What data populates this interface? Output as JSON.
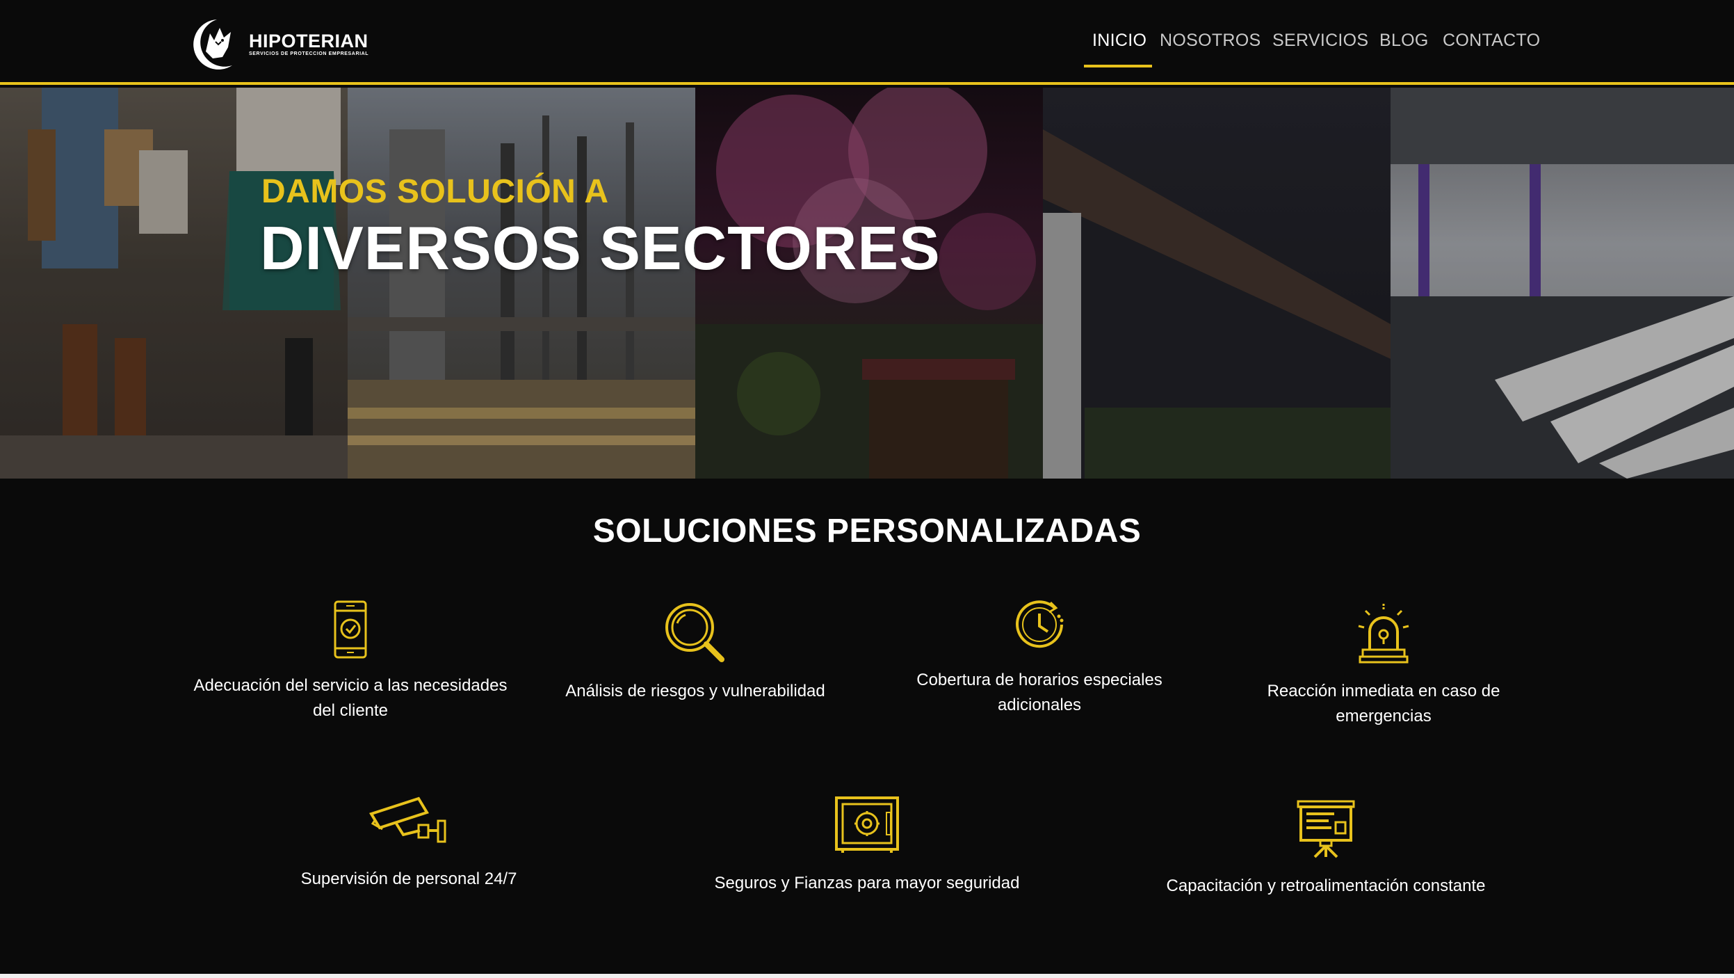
{
  "brand": {
    "name": "HIPOTERIAN",
    "tagline": "SERVICIOS DE PROTECCION EMPRESARIAL",
    "accent_color": "#e8c21c"
  },
  "nav": {
    "items": [
      {
        "label": "INICIO",
        "active": true
      },
      {
        "label": "NOSOTROS",
        "active": false
      },
      {
        "label": "SERVICIOS",
        "active": false
      },
      {
        "label": "BLOG",
        "active": false
      },
      {
        "label": "CONTACTO",
        "active": false
      }
    ]
  },
  "hero": {
    "kicker": "DAMOS SOLUCIÓN A",
    "title": "DIVERSOS SECTORES",
    "panels": [
      "retail-shoppers",
      "construction-site",
      "event-fireworks",
      "building-exterior",
      "office-interior"
    ]
  },
  "solutions": {
    "title": "SOLUCIONES PERSONALIZADAS",
    "items": [
      {
        "icon": "phone-check-icon",
        "label": "Adecuación del servicio a las necesidades del cliente"
      },
      {
        "icon": "magnifier-icon",
        "label": "Análisis de riesgos y vulnerabilidad"
      },
      {
        "icon": "clock-icon",
        "label": "Cobertura de horarios especiales adicionales"
      },
      {
        "icon": "siren-icon",
        "label": "Reacción inmediata en caso de emergencias"
      },
      {
        "icon": "security-camera-icon",
        "label": "Supervisión de personal 24/7"
      },
      {
        "icon": "safe-icon",
        "label": "Seguros y Fianzas para mayor seguridad"
      },
      {
        "icon": "presentation-board-icon",
        "label": "Capacitación y retroalimentación constante"
      }
    ]
  }
}
